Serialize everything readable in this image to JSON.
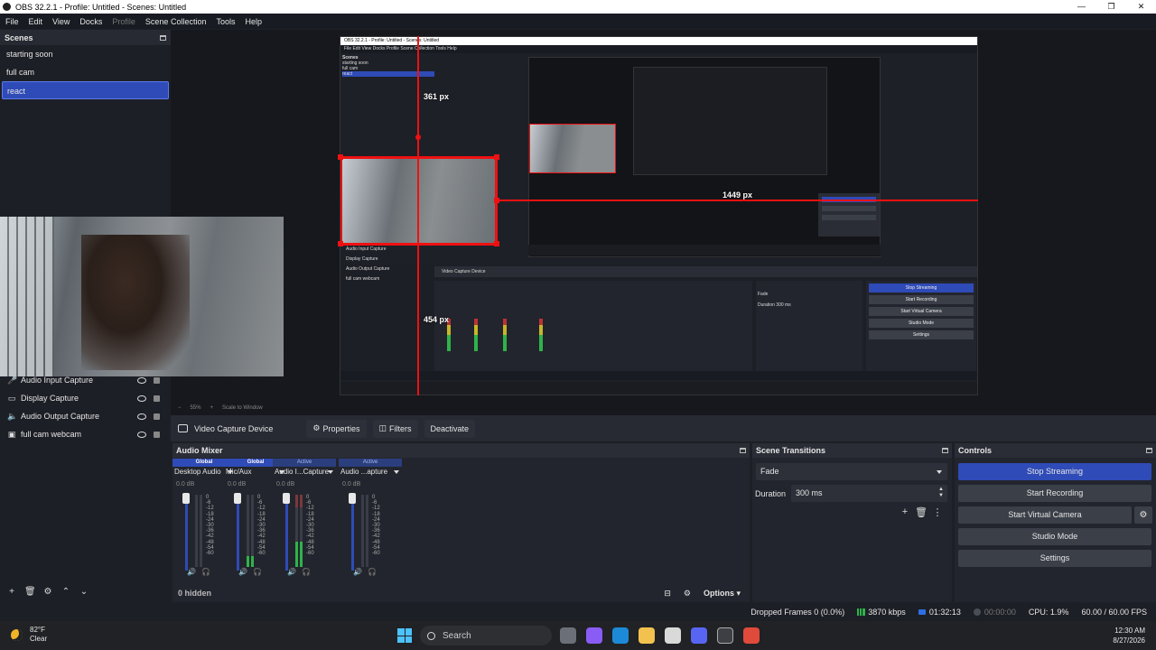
{
  "window": {
    "title": "OBS 32.2.1 - Profile: Untitled - Scenes: Untitled",
    "controls": [
      "—",
      "❐",
      "✕"
    ]
  },
  "menu": [
    "File",
    "Edit",
    "View",
    "Docks",
    "Profile",
    "Scene Collection",
    "Tools",
    "Help"
  ],
  "scenes": {
    "title": "Scenes",
    "items": [
      "starting soon",
      "full cam",
      "react"
    ],
    "selected": "react"
  },
  "sources": {
    "items": [
      {
        "label": "Audio Input Capture",
        "icon": "microphone-icon"
      },
      {
        "label": "Display Capture",
        "icon": "monitor-icon"
      },
      {
        "label": "Audio Output Capture",
        "icon": "speaker-icon"
      },
      {
        "label": "full cam webcam",
        "icon": "camera-icon"
      }
    ]
  },
  "preview": {
    "measure_top": "361 px",
    "measure_right": "1449 px",
    "measure_left": "454 px",
    "nested_title": "OBS 32.2.1 - Profile: Untitled - Scenes: Untitled",
    "nested_menu": "File  Edit  View  Docks  Profile  Scene Collection  Tools  Help",
    "nested_scenes": [
      "Scenes",
      "starting soon",
      "full cam",
      "react"
    ],
    "nested_sources": [
      "Audio Input Capture",
      "Display Capture",
      "Audio Output Capture",
      "full cam webcam"
    ],
    "nested_controls": [
      "Stop Streaming",
      "Start Recording",
      "Start Virtual Camera",
      "Studio Mode",
      "Settings"
    ],
    "nested_prop": "Video Capture Device",
    "nested_fade": "Fade",
    "nested_duration": "Duration 300 ms"
  },
  "zoom": {
    "minus": "−",
    "level": "55%",
    "plus": "+",
    "mode": "Scale to Window"
  },
  "context": {
    "source_name": "Video Capture Device",
    "properties": "Properties",
    "filters": "Filters",
    "deactivate": "Deactivate"
  },
  "mixer": {
    "title": "Audio Mixer",
    "hidden": "0 hidden",
    "options": "Options",
    "scale": [
      "0",
      "-6",
      "-12",
      "-18",
      "-24",
      "-30",
      "-36",
      "-42",
      "-48",
      "-54",
      "-60"
    ],
    "channels": [
      {
        "badge": "Global",
        "name": "Desktop Audio",
        "db": "0.0 dB",
        "level": 0.0,
        "active": false
      },
      {
        "badge": "Global",
        "name": "Mic/Aux",
        "db": "0.0 dB",
        "level": 0.15,
        "active": false
      },
      {
        "badge": "Active",
        "name": "Audio I...Capture",
        "db": "0.0 dB",
        "level": 0.35,
        "active": true
      },
      {
        "badge": "Active",
        "name": "Audio ...apture",
        "db": "0.0 dB",
        "level": 0.0,
        "active": true
      }
    ]
  },
  "transitions": {
    "title": "Scene Transitions",
    "selected": "Fade",
    "duration_label": "Duration",
    "duration_value": "300 ms"
  },
  "controls": {
    "title": "Controls",
    "stop_streaming": "Stop Streaming",
    "start_recording": "Start Recording",
    "start_virtual_camera": "Start Virtual Camera",
    "studio_mode": "Studio Mode",
    "settings": "Settings"
  },
  "status": {
    "dropped_frames": "Dropped Frames 0 (0.0%)",
    "bitrate": "3870 kbps",
    "stream_time": "01:32:13",
    "rec_time": "00:00:00",
    "cpu": "CPU: 1.9%",
    "fps": "60.00 / 60.00 FPS"
  },
  "taskbar": {
    "temp": "82°F",
    "weather": "Clear",
    "search": "Search",
    "time": "12:30 AM",
    "date": "8/27/2026"
  },
  "colors": {
    "accent": "#2f4bb7",
    "panel": "#22252d",
    "background": "#1d1f26",
    "guide": "#e11111"
  }
}
